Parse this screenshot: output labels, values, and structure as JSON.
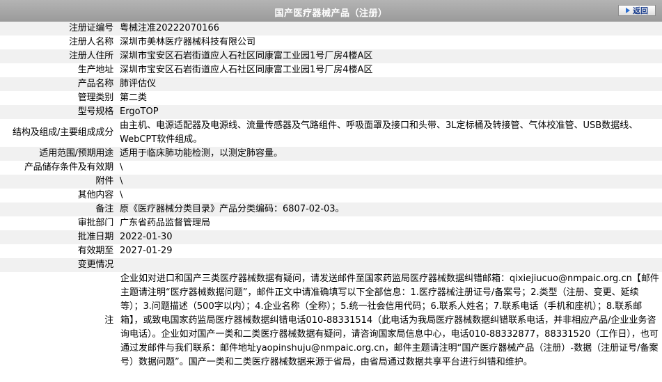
{
  "header": {
    "title": "国产医疗器械产品（注册）",
    "back_label": "返回"
  },
  "rows": [
    {
      "label": "注册证编号",
      "value": "粤械注准20222070166"
    },
    {
      "label": "注册人名称",
      "value": "深圳市美林医疗器械科技有限公司"
    },
    {
      "label": "注册人住所",
      "value": "深圳市宝安区石岩街道应人石社区同康富工业园1号厂房4楼A区"
    },
    {
      "label": "生产地址",
      "value": "深圳市宝安区石岩街道应人石社区同康富工业园1号厂房4楼A区"
    },
    {
      "label": "产品名称",
      "value": "肺评估仪"
    },
    {
      "label": "管理类别",
      "value": "第二类"
    },
    {
      "label": "型号规格",
      "value": "ErgoTOP"
    },
    {
      "label": "结构及组成/主要组成成分",
      "value": "由主机、电源适配器及电源线、流量传感器及气路组件、呼吸面罩及接口和头带、3L定标桶及转接管、气体校准管、USB数据线、WebCPT软件组成。"
    },
    {
      "label": "适用范围/预期用途",
      "value": "适用于临床肺功能检测，以测定肺容量。"
    },
    {
      "label": "产品储存条件及有效期",
      "value": "\\"
    },
    {
      "label": "附件",
      "value": "\\"
    },
    {
      "label": "其他内容",
      "value": "\\"
    },
    {
      "label": "备注",
      "value": "原《医疗器械分类目录》产品分类编码：6807-02-03。"
    },
    {
      "label": "审批部门",
      "value": "广东省药品监督管理局"
    },
    {
      "label": "批准日期",
      "value": "2022-01-30"
    },
    {
      "label": "有效期至",
      "value": "2027-01-29"
    },
    {
      "label": "变更情况",
      "value": ""
    }
  ],
  "note": {
    "label": "注",
    "text": "企业如对进口和国产三类医疗器械数据有疑问，请发送邮件至国家药监局医疗器械数据纠错邮箱：qixiejiucuo@nmpaic.org.cn【邮件主题请注明“医疗器械数据问题”，邮件正文中请准确填写以下全部信息：1.医疗器械注册证号/备案号；2.类型（注册、变更、延续等）；3.问题描述（500字以内）；4.企业名称（全称）；5.统一社会信用代码；6.联系人姓名；7.联系电话（手机和座机）；8.联系邮箱】，或致电国家药监局医疗器械数据纠错电话010-88331514（此电话为我局医疗器械数据纠错联系电话，并非相应产品/企业业务咨询电话）。企业如对国产一类和二类医疗器械数据有疑问，请咨询国家局信息中心，电话010-88332877，88331520（工作日），也可通过发邮件与我们联系：邮件地址yaopinshuju@nmpaic.org.cn，邮件主题请注明“国产医疗器械产品（注册）-数据（注册证号/备案号）数据问题”。国产一类和二类医疗器械数据来源于省局，由省局通过数据共享平台进行纠错和维护。"
  }
}
